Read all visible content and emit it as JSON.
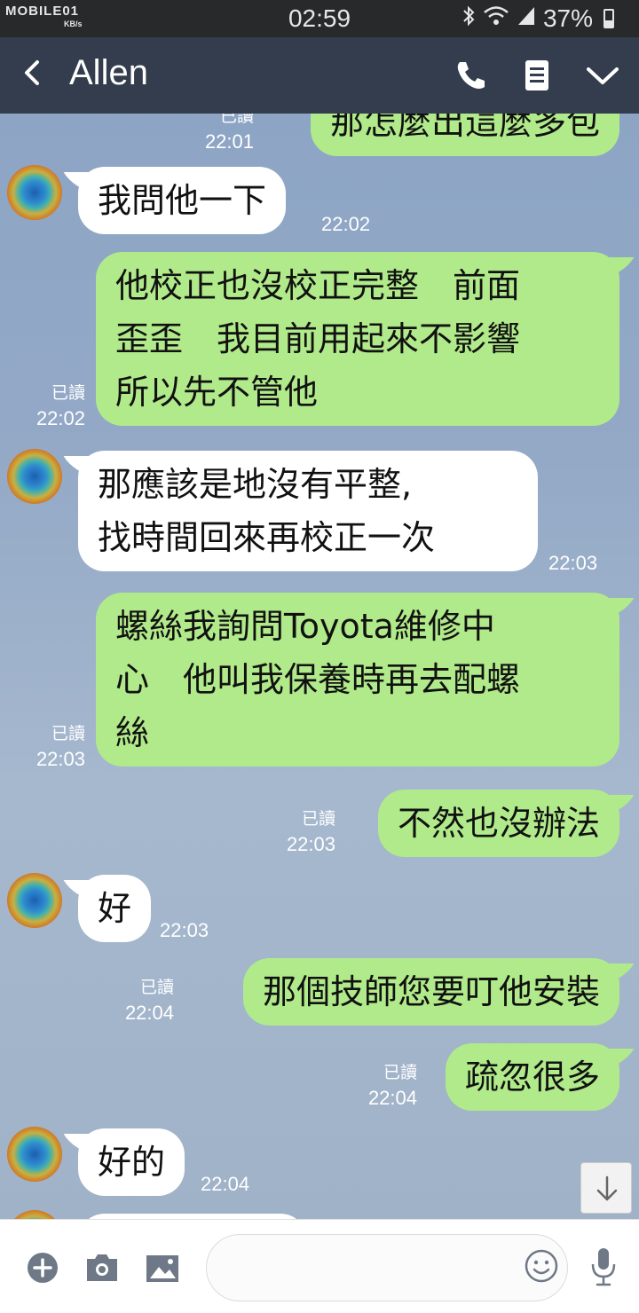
{
  "status_bar": {
    "carrier_logo": "MOBILE01",
    "speed_unit": "KB/s",
    "time": "02:59",
    "battery": "37%",
    "icons": [
      "bluetooth-icon",
      "wifi-icon",
      "signal-icon",
      "battery-icon"
    ]
  },
  "header": {
    "title": "Allen",
    "icons": [
      "back-icon",
      "phone-icon",
      "notes-icon",
      "chevron-down-icon"
    ]
  },
  "messages": [
    {
      "side": "out",
      "text": "那怎麼出這麼多包",
      "read": "已讀",
      "time": "22:01"
    },
    {
      "side": "in",
      "text": "我問他一下",
      "time": "22:02"
    },
    {
      "side": "out",
      "lines": [
        "他校正也沒校正完整　前面",
        "歪歪　我目前用起來不影響",
        "所以先不管他"
      ],
      "read": "已讀",
      "time": "22:02"
    },
    {
      "side": "in",
      "lines": [
        "那應該是地沒有平整,",
        "找時間回來再校正一次"
      ],
      "time": "22:03"
    },
    {
      "side": "out",
      "lines": [
        "螺絲我詢問Toyota維修中",
        "心　他叫我保養時再去配螺",
        "絲"
      ],
      "read": "已讀",
      "time": "22:03"
    },
    {
      "side": "out",
      "text": "不然也沒辦法",
      "read": "已讀",
      "time": "22:03"
    },
    {
      "side": "in",
      "text": "好",
      "time": "22:03"
    },
    {
      "side": "out",
      "text": "那個技師您要叮他安裝",
      "read": "已讀",
      "time": "22:04"
    },
    {
      "side": "out",
      "text": "疏忽很多",
      "read": "已讀",
      "time": "22:04"
    },
    {
      "side": "in",
      "text": "好的",
      "time": "22:04"
    }
  ],
  "input_bar": {
    "placeholder": "",
    "icons": [
      "add-icon",
      "camera-icon",
      "image-icon",
      "emoji-icon",
      "microphone-icon"
    ]
  },
  "colors": {
    "header_bg": "#333d4d",
    "status_bg": "#28292b",
    "outgoing_bubble": "#b1ea8a",
    "incoming_bubble": "#ffffff"
  }
}
